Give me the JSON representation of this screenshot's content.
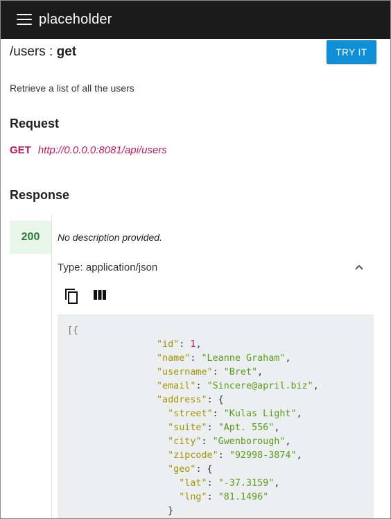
{
  "app": {
    "title": "placeholder",
    "menu_icon": "hamburger-menu-icon"
  },
  "operation": {
    "path": "/users",
    "separator": " : ",
    "method_word": "get",
    "try_label": "TRY IT",
    "description": "Retrieve a list of all the users"
  },
  "request": {
    "heading": "Request",
    "method": "GET",
    "url": "http://0.0.0.0:8081/api/users"
  },
  "response": {
    "heading": "Response",
    "status": "200",
    "status_color": "#2e7d32",
    "description": "No description provided.",
    "type_label": "Type: application/json",
    "tools": [
      "copy-icon",
      "columns-icon"
    ],
    "example": {
      "open": "[{",
      "fields": [
        {
          "key": "\"id\"",
          "value": "1",
          "kind": "number"
        },
        {
          "key": "\"name\"",
          "value": "\"Leanne Graham\"",
          "kind": "string"
        },
        {
          "key": "\"username\"",
          "value": "\"Bret\"",
          "kind": "string"
        },
        {
          "key": "\"email\"",
          "value": "\"Sincere@april.biz\"",
          "kind": "string"
        }
      ],
      "address_key": "\"address\"",
      "address": [
        {
          "key": "\"street\"",
          "value": "\"Kulas Light\""
        },
        {
          "key": "\"suite\"",
          "value": "\"Apt. 556\""
        },
        {
          "key": "\"city\"",
          "value": "\"Gwenborough\""
        },
        {
          "key": "\"zipcode\"",
          "value": "\"92998-3874\""
        }
      ],
      "geo_key": "\"geo\"",
      "geo": [
        {
          "key": "\"lat\"",
          "value": "\"-37.3159\""
        },
        {
          "key": "\"lng\"",
          "value": "\"81.1496\""
        }
      ]
    }
  },
  "colors": {
    "topbar": "#1b1b1b",
    "accent": "#0e8fd6",
    "method": "#c2185b",
    "json_key": "#a39600",
    "json_string": "#5a9b1a",
    "code_bg": "#eceff1"
  }
}
